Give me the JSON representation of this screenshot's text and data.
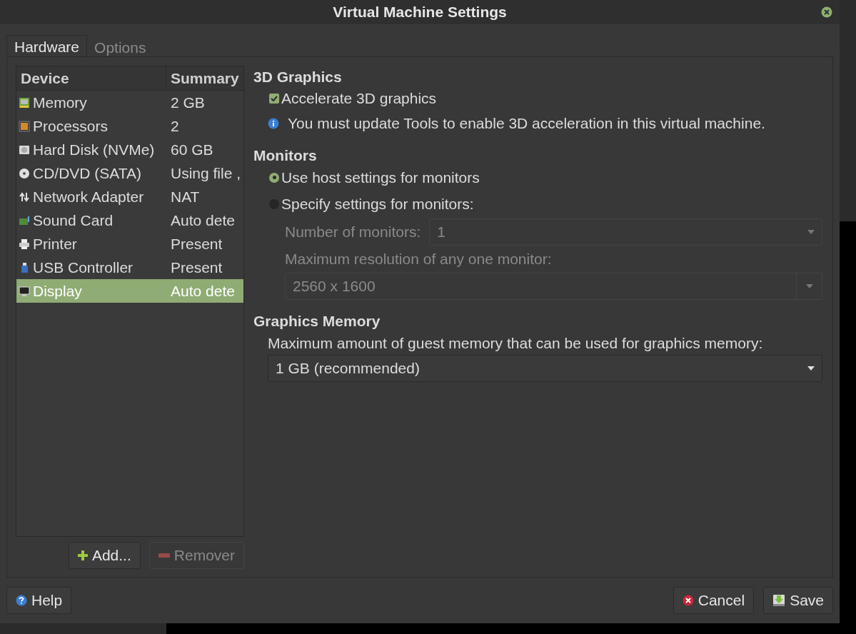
{
  "window": {
    "title": "Virtual Machine Settings"
  },
  "tabs": [
    {
      "label": "Hardware",
      "selected": true
    },
    {
      "label": "Options",
      "selected": false
    }
  ],
  "device_table": {
    "columns": [
      "Device",
      "Summary"
    ],
    "rows": [
      {
        "kind": "memory",
        "device": "Memory",
        "summary": "2 GB",
        "selected": false
      },
      {
        "kind": "processor",
        "device": "Processors",
        "summary": "2",
        "selected": false
      },
      {
        "kind": "disk",
        "device": "Hard Disk (NVMe)",
        "summary": "60 GB",
        "selected": false
      },
      {
        "kind": "cd",
        "device": "CD/DVD (SATA)",
        "summary": "Using file ,",
        "selected": false
      },
      {
        "kind": "network",
        "device": "Network Adapter",
        "summary": "NAT",
        "selected": false
      },
      {
        "kind": "sound",
        "device": "Sound Card",
        "summary": "Auto dete",
        "selected": false
      },
      {
        "kind": "printer",
        "device": "Printer",
        "summary": "Present",
        "selected": false
      },
      {
        "kind": "usb",
        "device": "USB Controller",
        "summary": "Present",
        "selected": false
      },
      {
        "kind": "display",
        "device": "Display",
        "summary": "Auto dete",
        "selected": true
      }
    ]
  },
  "device_buttons": [
    {
      "kind": "add",
      "label": "Add...",
      "disabled": false
    },
    {
      "kind": "remove",
      "label": "Remover",
      "disabled": true
    }
  ],
  "graphics_3d": {
    "heading": "3D Graphics",
    "accelerate": {
      "label": "Accelerate 3D graphics",
      "checked": true
    },
    "info": "You must update Tools to enable 3D acceleration in this virtual machine."
  },
  "monitors": {
    "heading": "Monitors",
    "options": [
      {
        "label": "Use host settings for monitors",
        "selected": true
      },
      {
        "label": "Specify settings for monitors:",
        "selected": false
      }
    ],
    "number_label": "Number of monitors:",
    "number_value": "1",
    "resolution_label": "Maximum resolution of any one monitor:",
    "resolution_value": "2560 x 1600",
    "disabled": true
  },
  "graphics_memory": {
    "heading": "Graphics Memory",
    "label": "Maximum amount of guest memory that can be used for graphics memory:",
    "value": "1 GB (recommended)"
  },
  "footer_buttons": [
    {
      "kind": "help",
      "label": "Help"
    },
    {
      "kind": "cancel",
      "label": "Cancel"
    },
    {
      "kind": "save",
      "label": "Save"
    }
  ]
}
